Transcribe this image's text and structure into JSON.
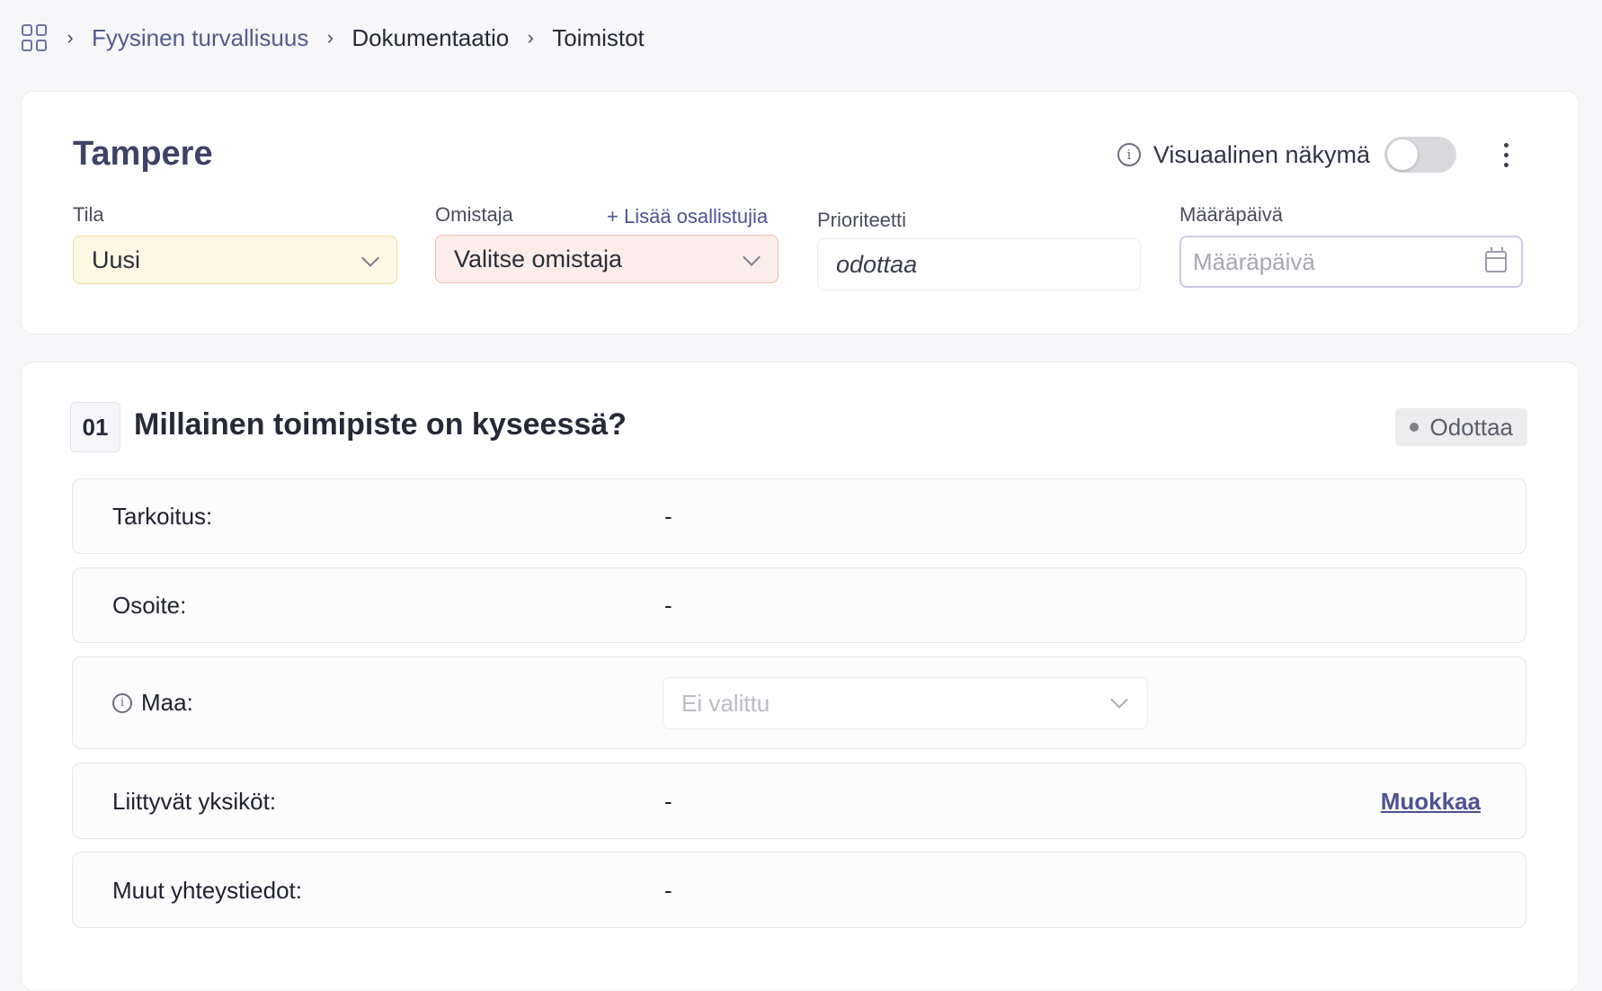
{
  "breadcrumb": {
    "items": [
      "Fyysinen turvallisuus",
      "Dokumentaatio",
      "Toimistot"
    ]
  },
  "header": {
    "title": "Tampere",
    "visual_view_label": "Visuaalinen näkymä",
    "visual_view_enabled": false
  },
  "fields": {
    "status_label": "Tila",
    "status_value": "Uusi",
    "owner_label": "Omistaja",
    "owner_placeholder": "Valitse omistaja",
    "add_participants": "+ Lisää osallistujia",
    "priority_label": "Prioriteetti",
    "priority_value": "odottaa",
    "due_date_label": "Määräpäivä",
    "due_date_placeholder": "Määräpäivä"
  },
  "question": {
    "number": "01",
    "title": "Millainen toimipiste on kyseessä?",
    "status": "Odottaa",
    "rows": [
      {
        "label": "Tarkoitus:",
        "value": "-"
      },
      {
        "label": "Osoite:",
        "value": "-"
      },
      {
        "label": "Maa:",
        "select_placeholder": "Ei valittu"
      },
      {
        "label": "Liittyvät yksiköt:",
        "value": "-",
        "action": "Muokkaa"
      },
      {
        "label": "Muut yhteystiedot:",
        "value": "-"
      }
    ]
  },
  "colors": {
    "accent": "#54598f",
    "status_bg": "#fdf8e4",
    "owner_bg": "#fcecea"
  }
}
